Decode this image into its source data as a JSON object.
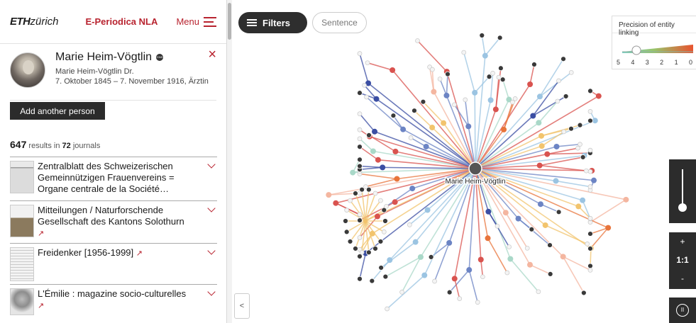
{
  "header": {
    "logo_bold": "ETH",
    "logo_rest": "zürich",
    "brand": "E-Periodica NLA",
    "menu_label": "Menu"
  },
  "person": {
    "name": "Marie Heim-Vögtlin",
    "gnd_badge": "GND",
    "alias": "Marie Heim-Vögtlin Dr.",
    "details": "7. Oktober 1845 – 7. November 1916, Ärztin",
    "close": "×"
  },
  "add_person_label": "Add another person",
  "results": {
    "count": "647",
    "text1": "results in",
    "journals": "72",
    "text2": "journals"
  },
  "journals": [
    {
      "title": "Zentralblatt des Schweizerischen Gemeinnützigen Frauenvereins = Organe centrale de la Société…",
      "external": ""
    },
    {
      "title": "Mitteilungen / Naturforschende Gesellschaft des Kantons Solothurn",
      "external": "↗"
    },
    {
      "title": "Freidenker [1956-1999]",
      "external": "↗"
    },
    {
      "title": "L'Émilie : magazine socio-culturelles",
      "external": "↗"
    }
  ],
  "toolbar": {
    "filters_label": "Filters",
    "sentence_label": "Sentence"
  },
  "precision": {
    "title": "Precision of entity linking",
    "ticks": [
      "5",
      "4",
      "3",
      "2",
      "1",
      "0"
    ]
  },
  "graph": {
    "center_label": "Marie Heim-Vögtlin"
  },
  "zoom": {
    "plus": "+",
    "reset": "1:1",
    "minus": "-",
    "pause": "II"
  },
  "collapse_label": "<",
  "colors": {
    "brand": "#b8232f",
    "dark_button": "#2b2b2b",
    "edge_colors": [
      "#d9534f",
      "#e8743b",
      "#f2c46d",
      "#6c84c4",
      "#3b4ea3",
      "#9bc4e2",
      "#a9d8c8",
      "#f4b6a0"
    ]
  }
}
